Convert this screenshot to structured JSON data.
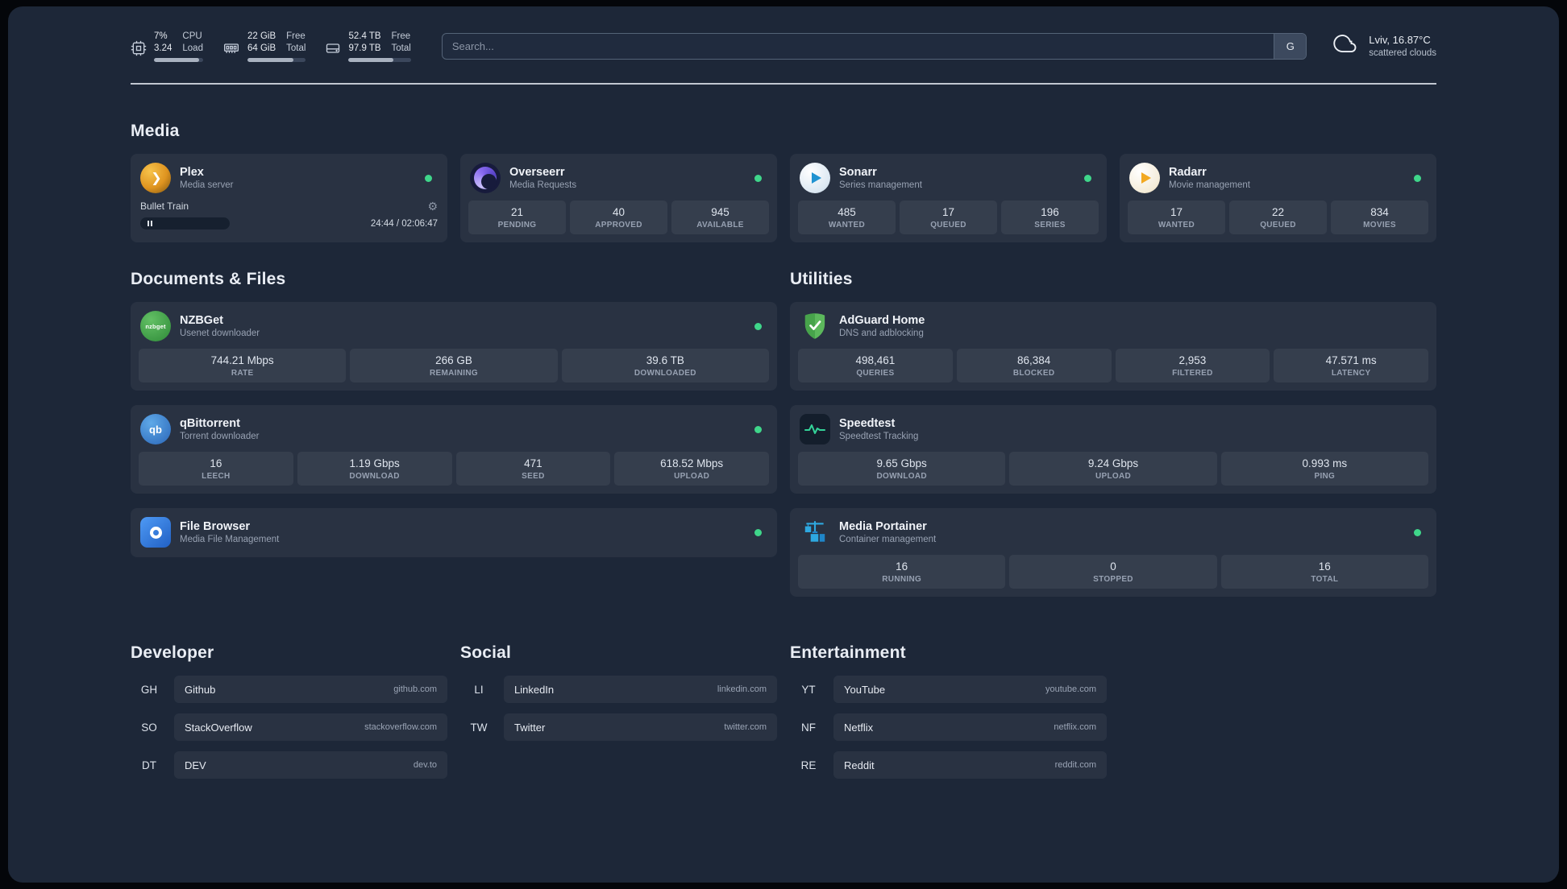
{
  "colors": {
    "background": "#1d2738",
    "card": "rgba(255,255,255,0.055)",
    "status_online": "#3fd68a",
    "plex_amber": "#df9420",
    "overseerr_purple": "#8b6cf0",
    "sonarr_blue": "#2193d1",
    "radarr_amber": "#f2a922",
    "nzbget_green": "#3daa57",
    "qbittorrent_blue": "#2a66b8",
    "filebrowser_blue": "#2160c4",
    "adguard_green": "#5cb85c",
    "speedtest_green": "#34d399",
    "portainer_blue": "#2ea8e0"
  },
  "topbar": {
    "cpu": {
      "icon": "cpu-chip-icon",
      "percent": "7%",
      "load": "3.24",
      "label1": "CPU",
      "label2": "Load",
      "bar_style": "width:92%"
    },
    "memory": {
      "icon": "memory-icon",
      "value1": "22 GiB",
      "value2": "64 GiB",
      "label1": "Free",
      "label2": "Total",
      "bar_style": "width:78%"
    },
    "disk": {
      "icon": "disk-icon",
      "value1": "52.4 TB",
      "value2": "97.9 TB",
      "label1": "Free",
      "label2": "Total",
      "bar_style": "width:72%"
    },
    "search": {
      "placeholder": "Search...",
      "provider": "G"
    },
    "weather": {
      "icon": "cloud-icon",
      "location": "Lviv, 16.87°C",
      "condition": "scattered clouds"
    }
  },
  "media": {
    "title": "Media",
    "cards": [
      {
        "icon": "plex-icon",
        "name": "Plex",
        "subtitle": "Media server",
        "status": "online",
        "player": {
          "track": "Bullet Train",
          "time": "24:44 / 02:06:47",
          "progress_style": "width:30%"
        }
      },
      {
        "icon": "overseerr-icon",
        "name": "Overseerr",
        "subtitle": "Media Requests",
        "status": "online",
        "stats": [
          {
            "value": "21",
            "label": "PENDING"
          },
          {
            "value": "40",
            "label": "APPROVED"
          },
          {
            "value": "945",
            "label": "AVAILABLE"
          }
        ]
      },
      {
        "icon": "sonarr-icon",
        "name": "Sonarr",
        "subtitle": "Series management",
        "status": "online",
        "stats": [
          {
            "value": "485",
            "label": "WANTED"
          },
          {
            "value": "17",
            "label": "QUEUED"
          },
          {
            "value": "196",
            "label": "SERIES"
          }
        ]
      },
      {
        "icon": "radarr-icon",
        "name": "Radarr",
        "subtitle": "Movie management",
        "status": "online",
        "stats": [
          {
            "value": "17",
            "label": "WANTED"
          },
          {
            "value": "22",
            "label": "QUEUED"
          },
          {
            "value": "834",
            "label": "MOVIES"
          }
        ]
      }
    ]
  },
  "documents": {
    "title": "Documents & Files",
    "cards": [
      {
        "icon": "nzbget-icon",
        "name": "NZBGet",
        "subtitle": "Usenet downloader",
        "status": "online",
        "stats": [
          {
            "value": "744.21 Mbps",
            "label": "RATE"
          },
          {
            "value": "266 GB",
            "label": "REMAINING"
          },
          {
            "value": "39.6 TB",
            "label": "DOWNLOADED"
          }
        ]
      },
      {
        "icon": "qbittorrent-icon",
        "name": "qBittorrent",
        "subtitle": "Torrent downloader",
        "status": "online",
        "stats": [
          {
            "value": "16",
            "label": "LEECH"
          },
          {
            "value": "1.19 Gbps",
            "label": "DOWNLOAD"
          },
          {
            "value": "471",
            "label": "SEED"
          },
          {
            "value": "618.52 Mbps",
            "label": "UPLOAD"
          }
        ]
      },
      {
        "icon": "filebrowser-icon",
        "name": "File Browser",
        "subtitle": "Media File Management",
        "status": "online",
        "stats": []
      }
    ]
  },
  "utilities": {
    "title": "Utilities",
    "cards": [
      {
        "icon": "adguard-icon",
        "name": "AdGuard Home",
        "subtitle": "DNS and adblocking",
        "stats": [
          {
            "value": "498,461",
            "label": "QUERIES"
          },
          {
            "value": "86,384",
            "label": "BLOCKED"
          },
          {
            "value": "2,953",
            "label": "FILTERED"
          },
          {
            "value": "47.571 ms",
            "label": "LATENCY"
          }
        ]
      },
      {
        "icon": "speedtest-icon",
        "name": "Speedtest",
        "subtitle": "Speedtest Tracking",
        "stats": [
          {
            "value": "9.65 Gbps",
            "label": "DOWNLOAD"
          },
          {
            "value": "9.24 Gbps",
            "label": "UPLOAD"
          },
          {
            "value": "0.993 ms",
            "label": "PING"
          }
        ]
      },
      {
        "icon": "portainer-icon",
        "name": "Media Portainer",
        "subtitle": "Container management",
        "status": "online",
        "stats": [
          {
            "value": "16",
            "label": "RUNNING"
          },
          {
            "value": "0",
            "label": "STOPPED"
          },
          {
            "value": "16",
            "label": "TOTAL"
          }
        ]
      }
    ]
  },
  "bookmarks": [
    {
      "title": "Developer",
      "items": [
        {
          "abbr": "GH",
          "name": "Github",
          "url": "github.com"
        },
        {
          "abbr": "SO",
          "name": "StackOverflow",
          "url": "stackoverflow.com"
        },
        {
          "abbr": "DT",
          "name": "DEV",
          "url": "dev.to"
        }
      ]
    },
    {
      "title": "Social",
      "items": [
        {
          "abbr": "LI",
          "name": "LinkedIn",
          "url": "linkedin.com"
        },
        {
          "abbr": "TW",
          "name": "Twitter",
          "url": "twitter.com"
        }
      ]
    },
    {
      "title": "Entertainment",
      "items": [
        {
          "abbr": "YT",
          "name": "YouTube",
          "url": "youtube.com"
        },
        {
          "abbr": "NF",
          "name": "Netflix",
          "url": "netflix.com"
        },
        {
          "abbr": "RE",
          "name": "Reddit",
          "url": "reddit.com"
        }
      ]
    }
  ]
}
